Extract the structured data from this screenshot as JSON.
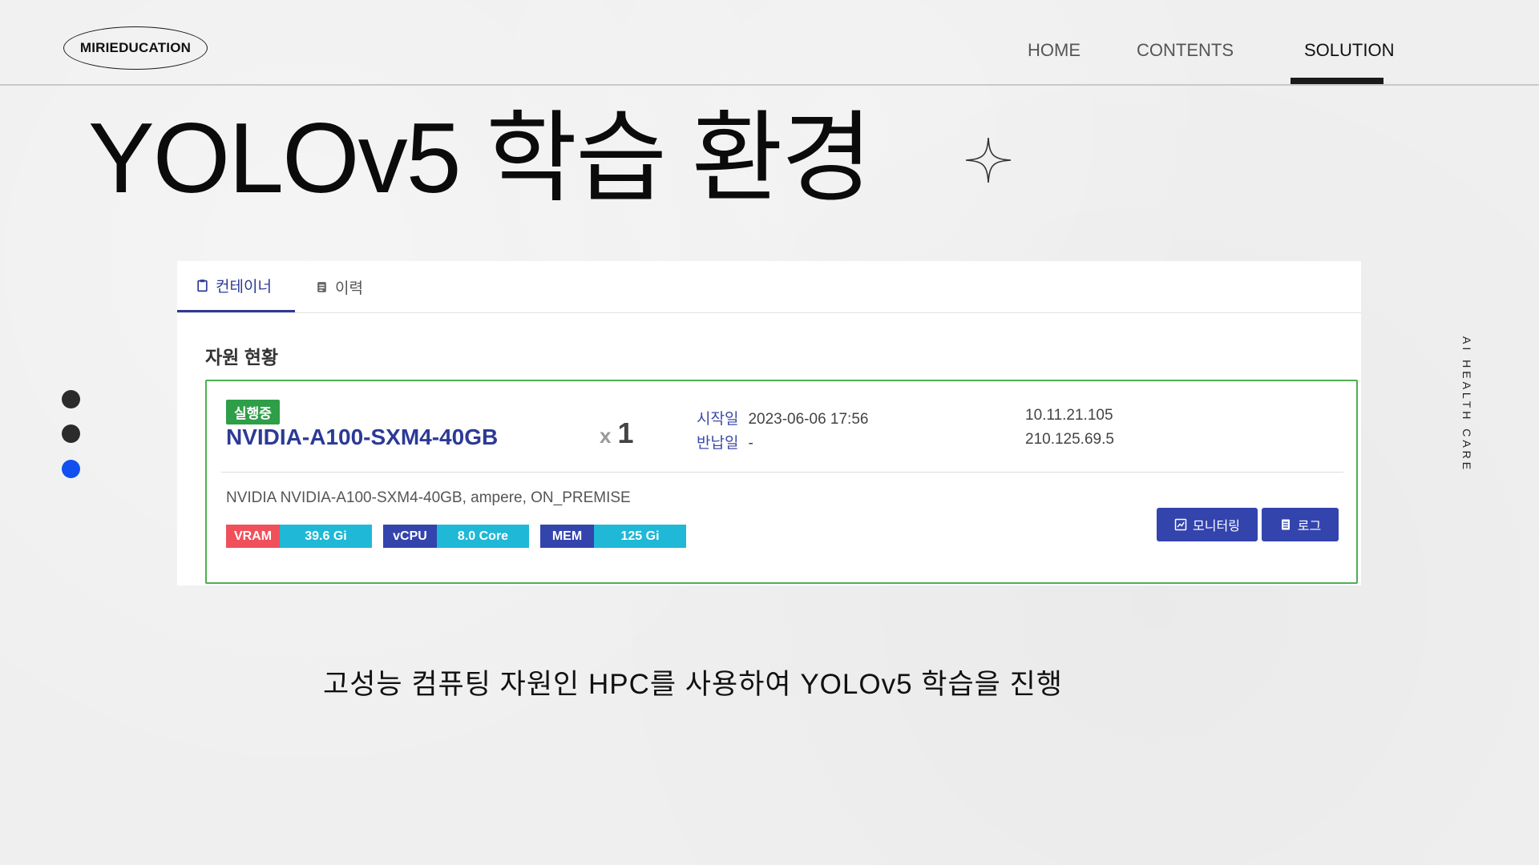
{
  "header": {
    "logo": "MIRIEDUCATION",
    "nav": [
      {
        "label": "HOME"
      },
      {
        "label": "CONTENTS"
      },
      {
        "label": "SOLUTION"
      }
    ],
    "active_nav": "SOLUTION"
  },
  "title": "YOLOv5 학습 환경",
  "side_text": "AI HEALTH CARE",
  "pager": {
    "count": 3,
    "active": 3
  },
  "panel": {
    "tabs": [
      {
        "label": "컨테이너",
        "icon": "clipboard-icon"
      },
      {
        "label": "이력",
        "icon": "history-icon"
      }
    ],
    "active_tab": "컨테이너",
    "section_title": "자원 현황",
    "card": {
      "status": "실행중",
      "gpu_name": "NVIDIA-A100-SXM4-40GB",
      "count_prefix": "x",
      "count": "1",
      "start_label": "시작일",
      "start_value": "2023-06-06 17:56",
      "return_label": "반납일",
      "return_value": "-",
      "ip_primary": "10.11.21.105",
      "ip_secondary": "210.125.69.5",
      "spec": "NVIDIA NVIDIA-A100-SXM4-40GB, ampere, ON_PREMISE",
      "resources": [
        {
          "label": "VRAM",
          "value": "39.6 Gi",
          "color": "#f0505a"
        },
        {
          "label": "vCPU",
          "value": "8.0 Core",
          "color": "#3344ad"
        },
        {
          "label": "MEM",
          "value": "125 Gi",
          "color": "#3344ad"
        }
      ],
      "buttons": [
        {
          "label": "모니터링",
          "icon": "chart-icon"
        },
        {
          "label": "로그",
          "icon": "document-icon"
        }
      ]
    }
  },
  "caption": "고성능 컴퓨팅 자원인 HPC를 사용하여  YOLOv5 학습을 진행",
  "colors": {
    "accent": "#2c3a96",
    "running": "#2e9e48",
    "card_border": "#4caf50",
    "resource_value": "#1fb8d6",
    "active_dot": "#1150ee"
  }
}
